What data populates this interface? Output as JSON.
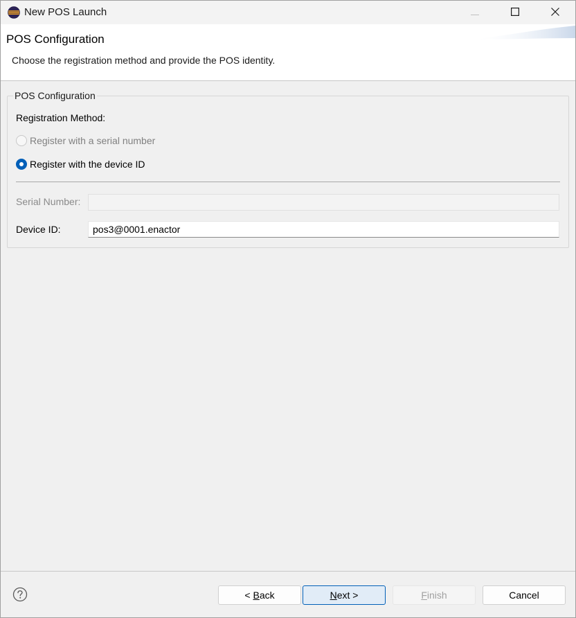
{
  "window": {
    "title": "New POS Launch",
    "controls": {
      "minimize": "minimize-icon",
      "maximize": "maximize-icon",
      "close": "close-icon"
    }
  },
  "header": {
    "title": "POS Configuration",
    "description": "Choose the registration method and provide the POS identity."
  },
  "group": {
    "label": "POS Configuration",
    "registration_method_label": "Registration Method:",
    "options": [
      {
        "label": "Register with a serial number",
        "selected": false,
        "enabled": false
      },
      {
        "label": "Register with the device ID",
        "selected": true,
        "enabled": true
      }
    ],
    "serial_number": {
      "label": "Serial Number:",
      "value": "",
      "enabled": false
    },
    "device_id": {
      "label": "Device ID:",
      "value": "pos3@0001.enactor",
      "enabled": true
    }
  },
  "footer": {
    "help_icon": "help-icon",
    "back": {
      "prefix": "< ",
      "mnemonic": "B",
      "rest": "ack"
    },
    "next": {
      "mnemonic": "N",
      "rest": "ext >"
    },
    "finish": {
      "mnemonic": "F",
      "rest": "inish",
      "enabled": false
    },
    "cancel": "Cancel"
  },
  "colors": {
    "accent": "#005fb8",
    "window_bg": "#f0f0f0",
    "header_bg": "#ffffff",
    "disabled_text": "#808080"
  }
}
